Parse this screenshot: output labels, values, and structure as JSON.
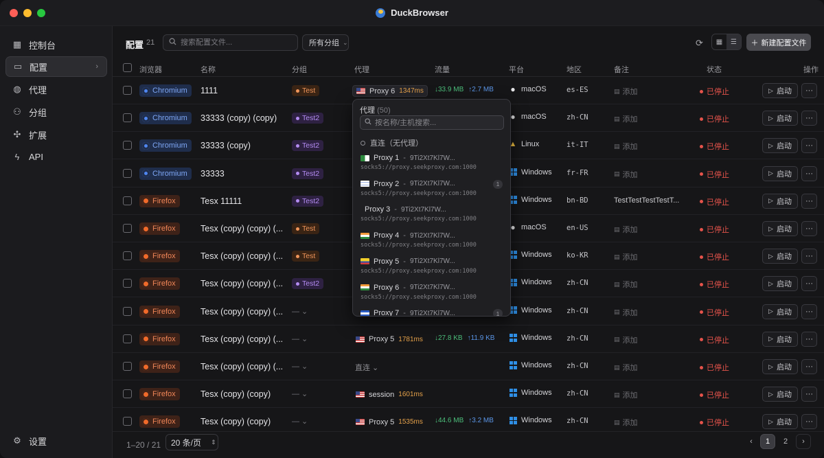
{
  "app": {
    "title": "DuckBrowser"
  },
  "sidebar": {
    "items": [
      {
        "label": "控制台",
        "icon": "grid-icon"
      },
      {
        "label": "配置",
        "icon": "monitor-icon",
        "active": true
      },
      {
        "label": "代理",
        "icon": "globe-icon"
      },
      {
        "label": "分组",
        "icon": "users-icon"
      },
      {
        "label": "扩展",
        "icon": "puzzle-icon"
      },
      {
        "label": "API",
        "icon": "bolt-icon"
      }
    ],
    "settings_label": "设置"
  },
  "toolbar": {
    "title": "配置",
    "count": "21",
    "search_placeholder": "搜索配置文件...",
    "group_filter": "所有分组",
    "new_button": "新建配置文件"
  },
  "table": {
    "columns": [
      "浏览器",
      "名称",
      "分组",
      "代理",
      "流量",
      "平台",
      "地区",
      "备注",
      "状态",
      "操作"
    ],
    "launch_label": "启动",
    "add_note_label": "添加",
    "rows": [
      {
        "browser": "Chromium",
        "name": "1111",
        "group": "Test",
        "group_color": "orange",
        "proxy": "Proxy 6",
        "latency": "1347ms",
        "down": "↓33.9 MB",
        "up": "↑2.7 MB",
        "platform": "macOS",
        "region": "es-ES",
        "note": "添加",
        "status": "已停止"
      },
      {
        "browser": "Chromium",
        "name": "33333 (copy) (copy)",
        "group": "Test2",
        "group_color": "purple",
        "platform": "macOS",
        "region": "zh-CN",
        "note": "添加",
        "status": "已停止"
      },
      {
        "browser": "Chromium",
        "name": "33333 (copy)",
        "group": "Test2",
        "group_color": "purple",
        "platform": "Linux",
        "region": "it-IT",
        "note": "添加",
        "status": "已停止"
      },
      {
        "browser": "Chromium",
        "name": "33333",
        "group": "Test2",
        "group_color": "purple",
        "platform": "Windows",
        "region": "fr-FR",
        "note": "添加",
        "status": "已停止"
      },
      {
        "browser": "Firefox",
        "name": "Tesx 11111",
        "group": "Test2",
        "group_color": "purple",
        "platform": "Windows",
        "region": "bn-BD",
        "note": "TestTestTestTestT...",
        "status": "已停止"
      },
      {
        "browser": "Firefox",
        "name": "Tesx (copy) (copy) (...",
        "group": "Test",
        "group_color": "orange",
        "platform": "macOS",
        "region": "en-US",
        "note": "添加",
        "status": "已停止"
      },
      {
        "browser": "Firefox",
        "name": "Tesx (copy) (copy) (...",
        "group": "Test",
        "group_color": "orange",
        "platform": "Windows",
        "region": "ko-KR",
        "note": "添加",
        "status": "已停止"
      },
      {
        "browser": "Firefox",
        "name": "Tesx (copy) (copy) (...",
        "group": "Test2",
        "group_color": "purple",
        "platform": "Windows",
        "region": "zh-CN",
        "note": "添加",
        "status": "已停止"
      },
      {
        "browser": "Firefox",
        "name": "Tesx (copy) (copy) (...",
        "group": "— ⌄",
        "platform": "Windows",
        "region": "zh-CN",
        "note": "添加",
        "status": "已停止"
      },
      {
        "browser": "Firefox",
        "name": "Tesx (copy) (copy) (...",
        "group": "— ⌄",
        "proxy": "Proxy 5",
        "latency": "1781ms",
        "down": "↓27.8 KB",
        "up": "↑11.9 KB",
        "platform": "Windows",
        "region": "zh-CN",
        "note": "添加",
        "status": "已停止"
      },
      {
        "browser": "Firefox",
        "name": "Tesx (copy) (copy) (...",
        "group": "— ⌄",
        "proxy_direct": "直连 ⌄",
        "platform": "Windows",
        "region": "zh-CN",
        "note": "添加",
        "status": "已停止"
      },
      {
        "browser": "Firefox",
        "name": "Tesx (copy) (copy)",
        "group": "— ⌄",
        "proxy": "session",
        "latency": "1601ms",
        "platform": "Windows",
        "region": "zh-CN",
        "note": "添加",
        "status": "已停止"
      },
      {
        "browser": "Firefox",
        "name": "Tesx (copy) (copy)",
        "group": "— ⌄",
        "proxy": "Proxy 5",
        "latency": "1535ms",
        "down": "↓44.6 MB",
        "up": "↑3.2 MB",
        "platform": "Windows",
        "region": "zh-CN",
        "note": "添加",
        "status": "已停止"
      }
    ]
  },
  "proxy_dropdown": {
    "title": "代理",
    "count": "(50)",
    "search_placeholder": "按名称/主机搜索...",
    "direct_label": "直连（无代理）",
    "items": [
      {
        "name": "Proxy 1",
        "id": "9Ti2Xt7Kl7W...",
        "host": "socks5://proxy.seekproxy.com:1000",
        "flag": "dz"
      },
      {
        "name": "Proxy 2",
        "id": "9Ti2Xt7Kl7W...",
        "host": "socks5://proxy.seekproxy.com:1000",
        "flag": "il",
        "badge": "1"
      },
      {
        "name": "Proxy 3",
        "id": "9Ti2Xt7Kl7W...",
        "host": "socks5://proxy.seekproxy.com:1000",
        "flag": "none"
      },
      {
        "name": "Proxy 4",
        "id": "9Ti2Xt7Kl7W...",
        "host": "socks5://proxy.seekproxy.com:1000",
        "flag": "in"
      },
      {
        "name": "Proxy 5",
        "id": "9Ti2Xt7Kl7W...",
        "host": "socks5://proxy.seekproxy.com:1000",
        "flag": "ec"
      },
      {
        "name": "Proxy 6",
        "id": "9Ti2Xt7Kl7W...",
        "host": "socks5://proxy.seekproxy.com:1000",
        "flag": "in"
      },
      {
        "name": "Proxy 7",
        "id": "9Ti2Xt7Kl7W...",
        "host": "",
        "flag": "sv",
        "badge": "1"
      }
    ]
  },
  "footer": {
    "range": "1–20 / 21",
    "page_size": "20 条/页",
    "pages": [
      "1",
      "2"
    ],
    "current_page": "1"
  }
}
